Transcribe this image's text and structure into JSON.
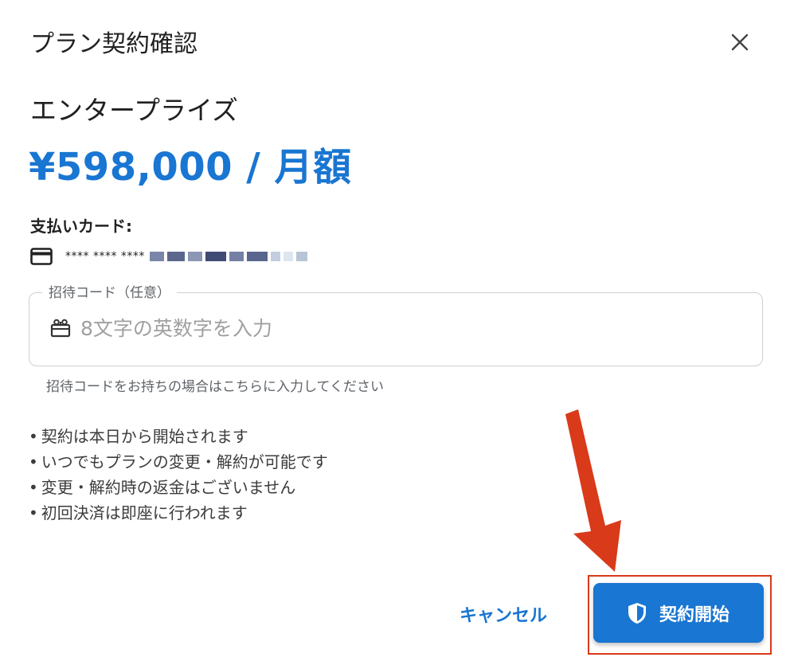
{
  "dialog": {
    "title": "プラン契約確認",
    "close_icon": "close-icon"
  },
  "plan": {
    "name": "エンタープライズ",
    "price": "¥598,000 / 月額"
  },
  "payment": {
    "label": "支払いカード:",
    "card_icon": "credit-card-icon",
    "masked_number": "**** **** ****"
  },
  "invite_code": {
    "label": "招待コード（任意）",
    "icon": "gift-icon",
    "placeholder": "8文字の英数字を入力",
    "value": "",
    "helper": "招待コードをお持ちの場合はこちらに入力してください"
  },
  "notes": [
    "契約は本日から開始されます",
    "いつでもプランの変更・解約が可能です",
    "変更・解約時の返金はございません",
    "初回決済は即座に行われます"
  ],
  "actions": {
    "cancel_label": "キャンセル",
    "start_label": "契約開始",
    "start_icon": "shield-icon"
  },
  "colors": {
    "accent": "#1976d2",
    "annotation": "#d93a1a"
  }
}
